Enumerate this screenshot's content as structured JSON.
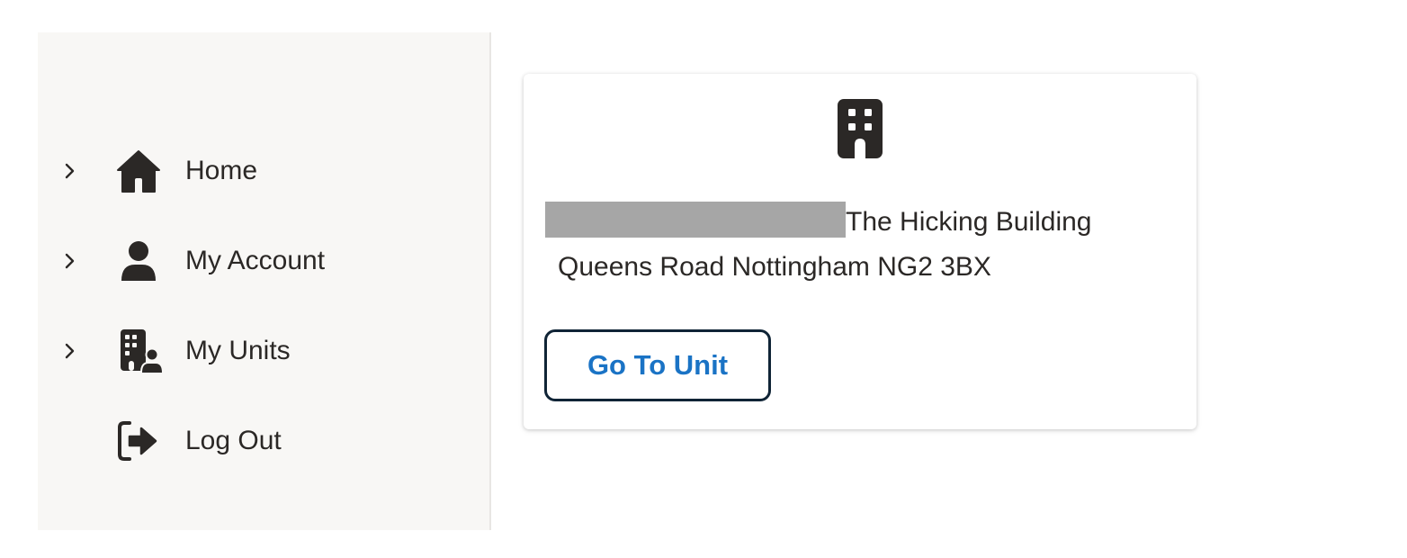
{
  "sidebar": {
    "items": [
      {
        "label": "Home",
        "icon": "home-icon",
        "has_chevron": true
      },
      {
        "label": "My Account",
        "icon": "user-icon",
        "has_chevron": true
      },
      {
        "label": "My Units",
        "icon": "building-user-icon",
        "has_chevron": true
      },
      {
        "label": "Log Out",
        "icon": "logout-icon",
        "has_chevron": false
      }
    ]
  },
  "unit_card": {
    "icon": "building-icon",
    "address_line1": "The Hicking Building",
    "address_line2": "Queens Road Nottingham NG2 3BX",
    "button_label": "Go To Unit"
  },
  "colors": {
    "sidebar_bg": "#f8f7f5",
    "text": "#2b2826",
    "button_text": "#1a73c5",
    "button_border": "#102436",
    "redaction": "#a6a6a6"
  }
}
